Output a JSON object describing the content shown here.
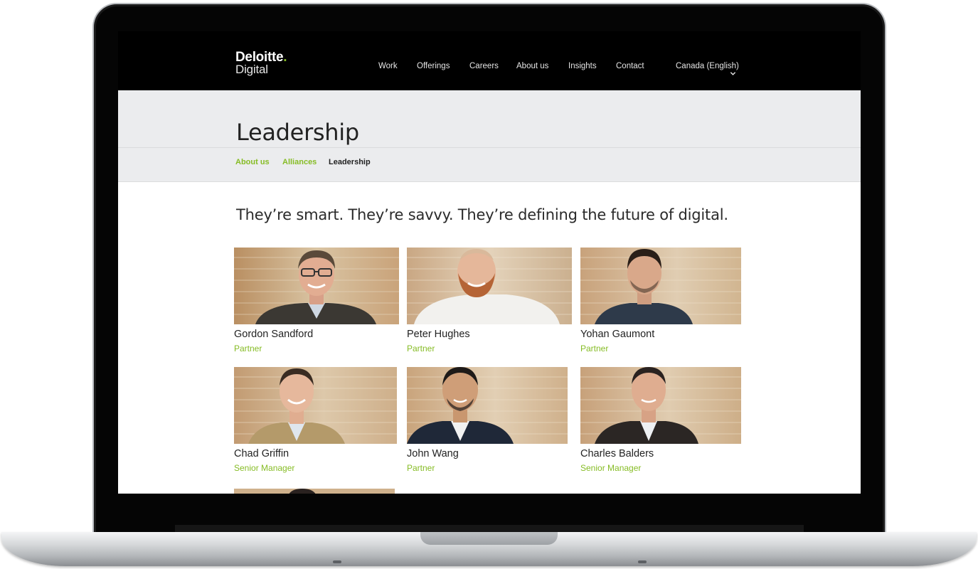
{
  "brand": {
    "name": "Deloitte",
    "dot": ".",
    "sub": "Digital",
    "accent": "#86bc25"
  },
  "nav": {
    "items": [
      {
        "label": "Work"
      },
      {
        "label": "Offerings"
      },
      {
        "label": "Careers"
      },
      {
        "label": "About us"
      },
      {
        "label": "Insights"
      },
      {
        "label": "Contact"
      }
    ],
    "language": "Canada (English)",
    "language_icon": "chevron-down-icon"
  },
  "page": {
    "title": "Leadership",
    "breadcrumb": [
      {
        "label": "About us",
        "state": "link"
      },
      {
        "label": "Alliances",
        "state": "link"
      },
      {
        "label": "Leadership",
        "state": "current"
      }
    ],
    "tagline": "They’re smart. They’re savvy. They’re defining the future of digital."
  },
  "people": [
    {
      "name": "Gordon Sandford",
      "role": "Partner"
    },
    {
      "name": "Peter Hughes",
      "role": "Partner"
    },
    {
      "name": "Yohan Gaumont",
      "role": "Partner"
    },
    {
      "name": "Chad Griffin",
      "role": "Senior Manager"
    },
    {
      "name": "John Wang",
      "role": "Partner"
    },
    {
      "name": "Charles Balders",
      "role": "Senior Manager"
    }
  ],
  "colors": {
    "link_green": "#86bc25",
    "header_bg": "#000000",
    "hero_bg": "#ebecee"
  }
}
